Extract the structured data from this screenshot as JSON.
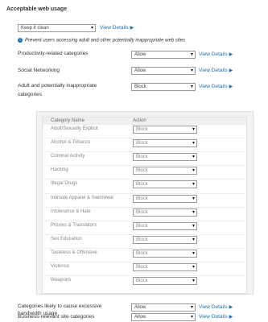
{
  "section_title": "Acceptable web usage",
  "preset": {
    "value": "Keep it clean",
    "view_details": "View Details"
  },
  "info_text": "Prevent users accessing adult and other potentially inappropriate web sites",
  "view_details_label": "View Details",
  "top_rows": [
    {
      "label": "Productivity-related categories",
      "value": "Allow"
    },
    {
      "label": "Social Networking",
      "value": "Allow"
    },
    {
      "label": "Adult and potentially inappropriate categories",
      "value": "Block"
    }
  ],
  "table": {
    "col_category": "Category Name",
    "col_action": "Action",
    "rows": [
      {
        "name": "Adult/Sexually Explicit",
        "action": "Block"
      },
      {
        "name": "Alcohol & Tobacco",
        "action": "Block"
      },
      {
        "name": "Criminal Activity",
        "action": "Block"
      },
      {
        "name": "Hacking",
        "action": "Block"
      },
      {
        "name": "Illegal Drugs",
        "action": "Block"
      },
      {
        "name": "Intimate Apparel & Swimwear",
        "action": "Block"
      },
      {
        "name": "Intolerance & Hate",
        "action": "Block"
      },
      {
        "name": "Proxies & Translators",
        "action": "Block"
      },
      {
        "name": "Sex Education",
        "action": "Block"
      },
      {
        "name": "Tasteless & Offensive",
        "action": "Block"
      },
      {
        "name": "Violence",
        "action": "Block"
      },
      {
        "name": "Weapons",
        "action": "Block"
      }
    ]
  },
  "bottom_rows": [
    {
      "label": "Categories likely to cause excessive bandwidth usage",
      "value": "Allow"
    },
    {
      "label": "Business-relevant site categories",
      "value": "Allow"
    }
  ],
  "icons": {
    "dropdown": "chevron-down-icon",
    "link_arrow": "triangle-right-icon",
    "info": "info-icon"
  },
  "colors": {
    "link": "#1e6fb3",
    "panel_bg": "#f3f3f3",
    "border": "#9a9a9a"
  }
}
